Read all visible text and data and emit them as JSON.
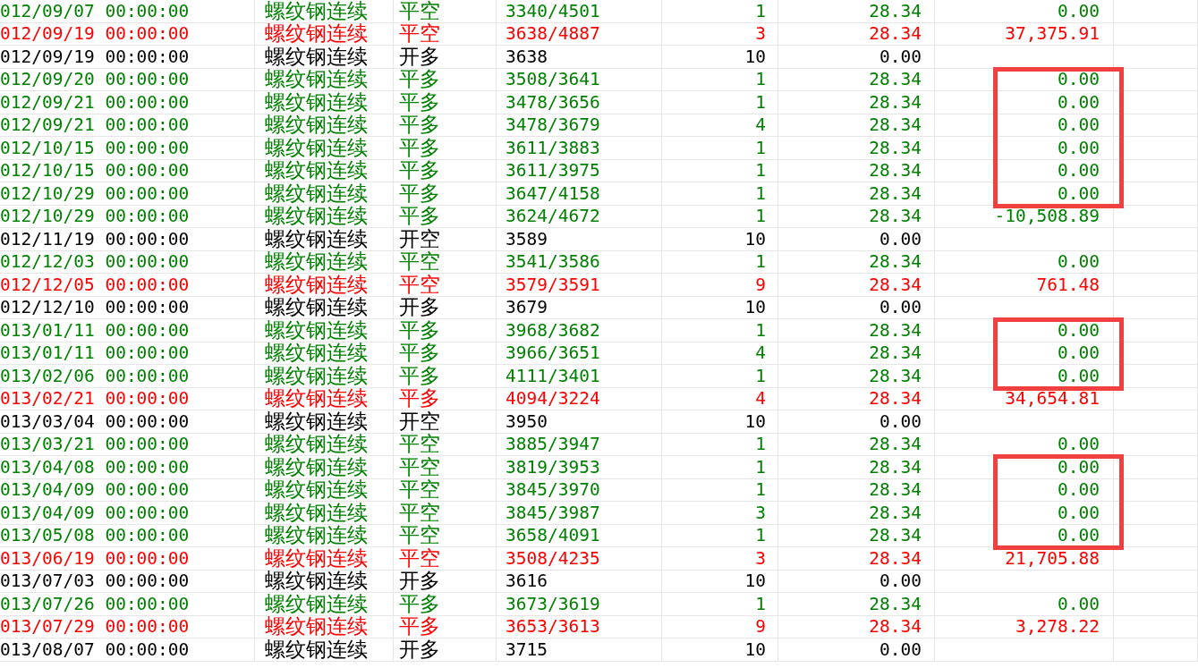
{
  "rows": [
    {
      "date": "012/09/07 00:00:00",
      "product": "螺纹钢连续",
      "action": "平空",
      "price": "3340/4501",
      "qty": "1",
      "fee": "28.34",
      "profit": "0.00",
      "color": "#008000",
      "boxed": false
    },
    {
      "date": "012/09/19 00:00:00",
      "product": "螺纹钢连续",
      "action": "平空",
      "price": "3638/4887",
      "qty": "3",
      "fee": "28.34",
      "profit": "37,375.91",
      "color": "#ff0000",
      "boxed": false
    },
    {
      "date": "012/09/19 00:00:00",
      "product": "螺纹钢连续",
      "action": "开多",
      "price": "3638",
      "qty": "10",
      "fee": "0.00",
      "color": "#000000",
      "boxed": false
    },
    {
      "date": "012/09/20 00:00:00",
      "product": "螺纹钢连续",
      "action": "平多",
      "price": "3508/3641",
      "qty": "1",
      "fee": "28.34",
      "profit": "0.00",
      "color": "#008000",
      "boxed": true
    },
    {
      "date": "012/09/21 00:00:00",
      "product": "螺纹钢连续",
      "action": "平多",
      "price": "3478/3656",
      "qty": "1",
      "fee": "28.34",
      "profit": "0.00",
      "color": "#008000",
      "boxed": true
    },
    {
      "date": "012/09/21 00:00:00",
      "product": "螺纹钢连续",
      "action": "平多",
      "price": "3478/3679",
      "qty": "4",
      "fee": "28.34",
      "profit": "0.00",
      "color": "#008000",
      "boxed": true
    },
    {
      "date": "012/10/15 00:00:00",
      "product": "螺纹钢连续",
      "action": "平多",
      "price": "3611/3883",
      "qty": "1",
      "fee": "28.34",
      "profit": "0.00",
      "color": "#008000",
      "boxed": true
    },
    {
      "date": "012/10/15 00:00:00",
      "product": "螺纹钢连续",
      "action": "平多",
      "price": "3611/3975",
      "qty": "1",
      "fee": "28.34",
      "profit": "0.00",
      "color": "#008000",
      "boxed": true
    },
    {
      "date": "012/10/29 00:00:00",
      "product": "螺纹钢连续",
      "action": "平多",
      "price": "3647/4158",
      "qty": "1",
      "fee": "28.34",
      "profit": "0.00",
      "color": "#008000",
      "boxed": true
    },
    {
      "date": "012/10/29 00:00:00",
      "product": "螺纹钢连续",
      "action": "平多",
      "price": "3624/4672",
      "qty": "1",
      "fee": "28.34",
      "profit": "-10,508.89",
      "color": "#008000",
      "boxed": false
    },
    {
      "date": "012/11/19 00:00:00",
      "product": "螺纹钢连续",
      "action": "开空",
      "price": "3589",
      "qty": "10",
      "fee": "0.00",
      "color": "#000000",
      "boxed": false
    },
    {
      "date": "012/12/03 00:00:00",
      "product": "螺纹钢连续",
      "action": "平空",
      "price": "3541/3586",
      "qty": "1",
      "fee": "28.34",
      "profit": "0.00",
      "color": "#008000",
      "boxed": false
    },
    {
      "date": "012/12/05 00:00:00",
      "product": "螺纹钢连续",
      "action": "平空",
      "price": "3579/3591",
      "qty": "9",
      "fee": "28.34",
      "profit": "761.48",
      "color": "#ff0000",
      "boxed": false
    },
    {
      "date": "012/12/10 00:00:00",
      "product": "螺纹钢连续",
      "action": "开多",
      "price": "3679",
      "qty": "10",
      "fee": "0.00",
      "color": "#000000",
      "boxed": false
    },
    {
      "date": "013/01/11 00:00:00",
      "product": "螺纹钢连续",
      "action": "平多",
      "price": "3968/3682",
      "qty": "1",
      "fee": "28.34",
      "profit": "0.00",
      "color": "#008000",
      "boxed": true
    },
    {
      "date": "013/01/11 00:00:00",
      "product": "螺纹钢连续",
      "action": "平多",
      "price": "3966/3651",
      "qty": "4",
      "fee": "28.34",
      "profit": "0.00",
      "color": "#008000",
      "boxed": true
    },
    {
      "date": "013/02/06 00:00:00",
      "product": "螺纹钢连续",
      "action": "平多",
      "price": "4111/3401",
      "qty": "1",
      "fee": "28.34",
      "profit": "0.00",
      "color": "#008000",
      "boxed": true
    },
    {
      "date": "013/02/21 00:00:00",
      "product": "螺纹钢连续",
      "action": "平多",
      "price": "4094/3224",
      "qty": "4",
      "fee": "28.34",
      "profit": "34,654.81",
      "color": "#ff0000",
      "boxed": false
    },
    {
      "date": "013/03/04 00:00:00",
      "product": "螺纹钢连续",
      "action": "开空",
      "price": "3950",
      "qty": "10",
      "fee": "0.00",
      "color": "#000000",
      "boxed": false
    },
    {
      "date": "013/03/21 00:00:00",
      "product": "螺纹钢连续",
      "action": "平空",
      "price": "3885/3947",
      "qty": "1",
      "fee": "28.34",
      "profit": "0.00",
      "color": "#008000",
      "boxed": false
    },
    {
      "date": "013/04/08 00:00:00",
      "product": "螺纹钢连续",
      "action": "平空",
      "price": "3819/3953",
      "qty": "1",
      "fee": "28.34",
      "profit": "0.00",
      "color": "#008000",
      "boxed": true
    },
    {
      "date": "013/04/09 00:00:00",
      "product": "螺纹钢连续",
      "action": "平空",
      "price": "3845/3970",
      "qty": "1",
      "fee": "28.34",
      "profit": "0.00",
      "color": "#008000",
      "boxed": true
    },
    {
      "date": "013/04/09 00:00:00",
      "product": "螺纹钢连续",
      "action": "平空",
      "price": "3845/3987",
      "qty": "3",
      "fee": "28.34",
      "profit": "0.00",
      "color": "#008000",
      "boxed": true
    },
    {
      "date": "013/05/08 00:00:00",
      "product": "螺纹钢连续",
      "action": "平空",
      "price": "3658/4091",
      "qty": "1",
      "fee": "28.34",
      "profit": "0.00",
      "color": "#008000",
      "boxed": true
    },
    {
      "date": "013/06/19 00:00:00",
      "product": "螺纹钢连续",
      "action": "平空",
      "price": "3508/4235",
      "qty": "3",
      "fee": "28.34",
      "profit": "21,705.88",
      "color": "#ff0000",
      "boxed": false
    },
    {
      "date": "013/07/03 00:00:00",
      "product": "螺纹钢连续",
      "action": "开多",
      "price": "3616",
      "qty": "10",
      "fee": "0.00",
      "color": "#000000",
      "boxed": false
    },
    {
      "date": "013/07/26 00:00:00",
      "product": "螺纹钢连续",
      "action": "平多",
      "price": "3673/3619",
      "qty": "1",
      "fee": "28.34",
      "profit": "0.00",
      "color": "#008000",
      "boxed": false
    },
    {
      "date": "013/07/29 00:00:00",
      "product": "螺纹钢连续",
      "action": "平多",
      "price": "3653/3613",
      "qty": "9",
      "fee": "28.34",
      "profit": "3,278.22",
      "color": "#ff0000",
      "boxed": false
    },
    {
      "date": "013/08/07 00:00:00",
      "product": "螺纹钢连续",
      "action": "开多",
      "price": "3715",
      "qty": "10",
      "fee": "0.00",
      "color": "#000000",
      "boxed": false
    }
  ]
}
